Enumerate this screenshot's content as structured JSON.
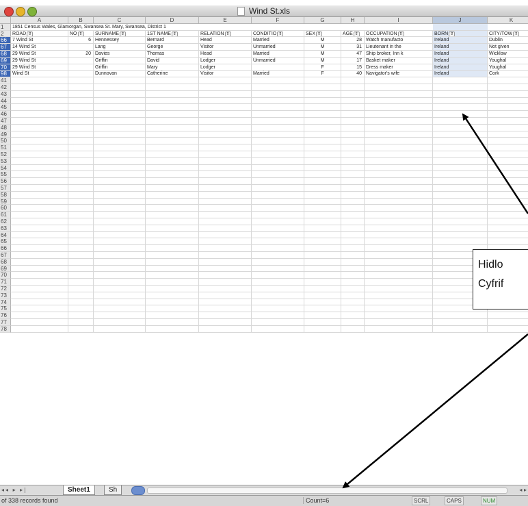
{
  "window": {
    "title": "Wind St.xls"
  },
  "columns": [
    "A",
    "B",
    "C",
    "D",
    "E",
    "F",
    "G",
    "H",
    "I",
    "J",
    "K"
  ],
  "row_numbers": [
    "",
    "1",
    "2",
    "66",
    "67",
    "68",
    "69",
    "70",
    "98",
    "41",
    "42",
    "43",
    "44",
    "45",
    "46",
    "47",
    "48",
    "49",
    "50",
    "51",
    "52",
    "53",
    "54",
    "55",
    "56",
    "57",
    "58",
    "59",
    "60",
    "61",
    "62",
    "63",
    "64",
    "65",
    "66",
    "67",
    "68",
    "69",
    "70",
    "71",
    "72",
    "73",
    "74",
    "75",
    "76",
    "77",
    "78"
  ],
  "title_row": "1851 Census Wales, Glamorgan, Swansea St. Mary, Swansea, District 1",
  "field_headers": [
    "ROAD",
    "NO",
    "SURNAME",
    "1ST NAME",
    "RELATION",
    "CONDITIO",
    "SEX",
    "AGE",
    "OCCUPATION",
    "BORN",
    "CITY/TOW"
  ],
  "records": [
    [
      "7 Wind St",
      "6",
      "Hennessey",
      "Bernard",
      "Head",
      "Married",
      "M",
      "28",
      "Watch manufacto",
      "Ireland",
      "Dublin"
    ],
    [
      "14 Wind St",
      "",
      "Lang",
      "George",
      "Visitor",
      "Unmarried",
      "M",
      "31",
      "Lieutenant in the",
      "Ireland",
      "Not given"
    ],
    [
      "29 Wind St",
      "20",
      "Davies",
      "Thomas",
      "Head",
      "Married",
      "M",
      "47",
      "Ship broker, Inn k",
      "Ireland",
      "Wicklow"
    ],
    [
      "29 Wind St",
      "",
      "Griffin",
      "David",
      "Lodger",
      "Unmarried",
      "M",
      "17",
      "Basket maker",
      "Ireland",
      "Youghal"
    ],
    [
      "29 Wind St",
      "",
      "Griffin",
      "Mary",
      "Lodger",
      "",
      "F",
      "15",
      "Dress maker",
      "Ireland",
      "Youghal"
    ],
    [
      "Wind St",
      "",
      "Dunnovan",
      "Catherine",
      "Visitor",
      "Married",
      "F",
      "40",
      "Navigator's wife",
      "Ireland",
      "Cork"
    ]
  ],
  "sheet_tabs": [
    "Sheet1",
    "Sh"
  ],
  "status": {
    "records_found": "of 338 records found",
    "count": "Count=6",
    "indicators": [
      "SCRL",
      "CAPS",
      "NUM"
    ]
  },
  "callout": {
    "line1": "Hidlo",
    "line2": "Cyfrif"
  },
  "colors": {
    "selected_row_header": "#3b66b5",
    "selected_column": "#dfe8f5",
    "num_indicator": "#2e8b2e"
  }
}
